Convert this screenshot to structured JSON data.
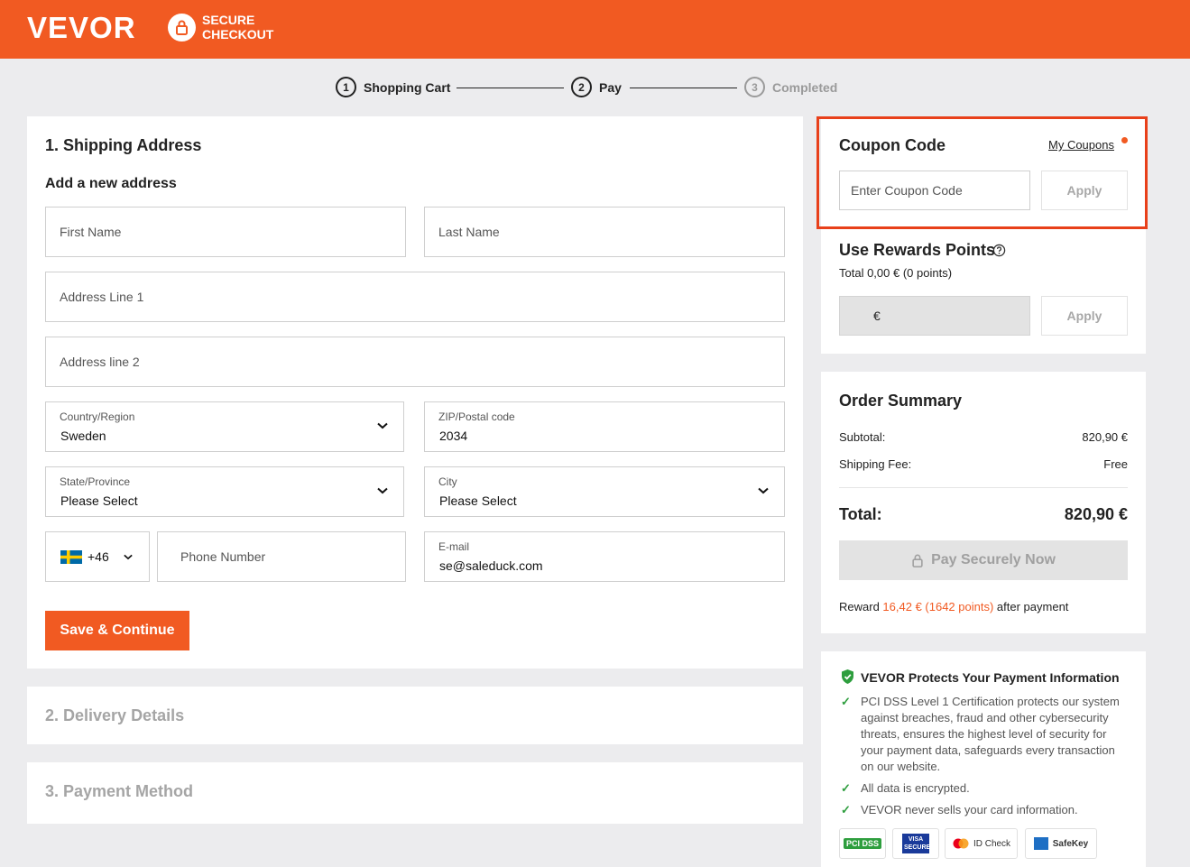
{
  "header": {
    "logo": "VEVOR",
    "secure_line1": "SECURE",
    "secure_line2": "CHECKOUT"
  },
  "steps": [
    {
      "num": "1",
      "label": "Shopping Cart"
    },
    {
      "num": "2",
      "label": "Pay"
    },
    {
      "num": "3",
      "label": "Completed"
    }
  ],
  "shipping": {
    "title": "1. Shipping Address",
    "subtitle": "Add a new address",
    "first_name_placeholder": "First Name",
    "last_name_placeholder": "Last Name",
    "address1_placeholder": "Address Line 1",
    "address2_placeholder": "Address line 2",
    "country_label": "Country/Region",
    "country_value": "Sweden",
    "zip_label": "ZIP/Postal code",
    "zip_value": "2034",
    "state_label": "State/Province",
    "state_value": "Please Select",
    "city_label": "City",
    "city_value": "Please Select",
    "phone_code": "+46",
    "phone_placeholder": "Phone Number",
    "email_label": "E-mail",
    "email_value": "se@saleduck.com",
    "save_button": "Save & Continue"
  },
  "delivery": {
    "title": "2. Delivery Details"
  },
  "payment": {
    "title": "3. Payment Method"
  },
  "coupon": {
    "title": "Coupon Code",
    "my_coupons": "My Coupons",
    "placeholder": "Enter Coupon Code",
    "apply": "Apply"
  },
  "rewards": {
    "title": "Use Rewards Points",
    "total": "Total 0,00 € (0 points)",
    "currency": "€",
    "apply": "Apply"
  },
  "summary": {
    "title": "Order Summary",
    "subtotal_label": "Subtotal:",
    "subtotal_value": "820,90 €",
    "shipping_label": "Shipping Fee:",
    "shipping_value": "Free",
    "total_label": "Total:",
    "total_value": "820,90 €",
    "pay_button": "Pay Securely Now",
    "reward_prefix": "Reward",
    "reward_amount": "16,42 € (1642 points)",
    "reward_suffix": "after payment"
  },
  "protection": {
    "title": "VEVOR Protects Your Payment Information",
    "items": [
      "PCI DSS Level 1 Certification protects our system against breaches, fraud and other cybersecurity threats, ensures the highest level of security for your payment data, safeguards every transaction on our website.",
      "All data is encrypted.",
      "VEVOR never sells your card information."
    ],
    "badges": [
      "PCI DSS",
      "VISA SECURE",
      "ID Check",
      "SafeKey"
    ]
  },
  "colors": {
    "brand": "#f15a22",
    "highlight_border": "#e8401a",
    "success": "#2e9e3e"
  }
}
